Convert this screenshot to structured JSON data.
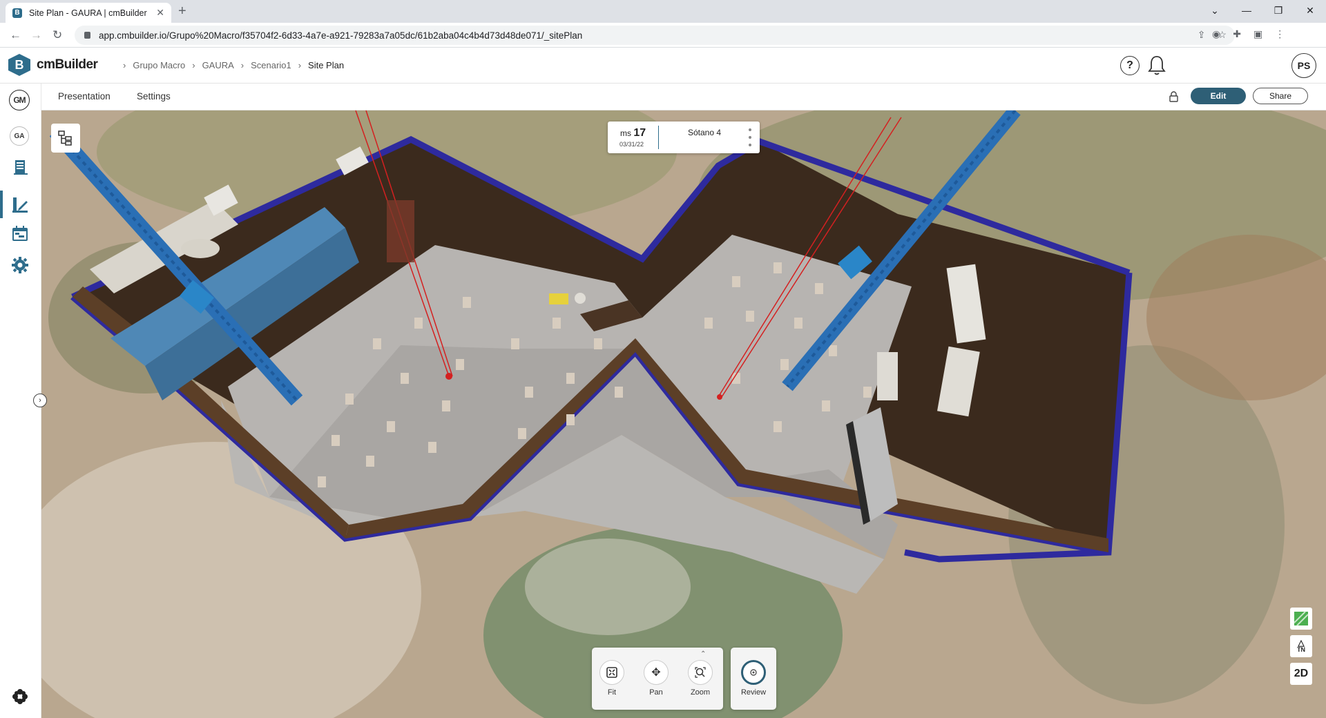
{
  "browser": {
    "tab_title": "Site Plan - GAURA | cmBuilder",
    "new_tab": "+",
    "url": "app.cmbuilder.io/Grupo%20Macro/f35704f2-6d33-4a7e-a921-79283a7a05dc/61b2aba04c4b4d73d48de071/_sitePlan"
  },
  "app": {
    "brand": "cmBuilder",
    "brand_letter": "B",
    "breadcrumb": [
      "Grupo Macro",
      "GAURA",
      "Scenario1",
      "Site Plan"
    ],
    "user_initials": "PS"
  },
  "sidebar": {
    "org_initials": "GM",
    "project_initials": "GA",
    "items": [
      "building-icon",
      "edit-plan-icon",
      "schedule-icon",
      "settings-icon"
    ],
    "active_color": "#2e6d8c"
  },
  "toolbar": {
    "tabs": [
      "Presentation",
      "Settings"
    ],
    "edit_label": "Edit",
    "share_label": "Share"
  },
  "milestone": {
    "prefix": "ms",
    "number": "17",
    "date": "03/31/22",
    "level": "Sótano 4"
  },
  "nav_controls": {
    "fit": "Fit",
    "pan": "Pan",
    "zoom": "Zoom",
    "review": "Review"
  },
  "right_controls": {
    "north_label": "TN",
    "view_mode": "2D"
  },
  "colors": {
    "accent": "#2e6d8c",
    "edit_button": "#2e5f76",
    "fence": "#3a2f9e",
    "crane": "#2a6fb5",
    "excavation_wall": "#3b2a1d",
    "slab": "#b7b4b1"
  }
}
